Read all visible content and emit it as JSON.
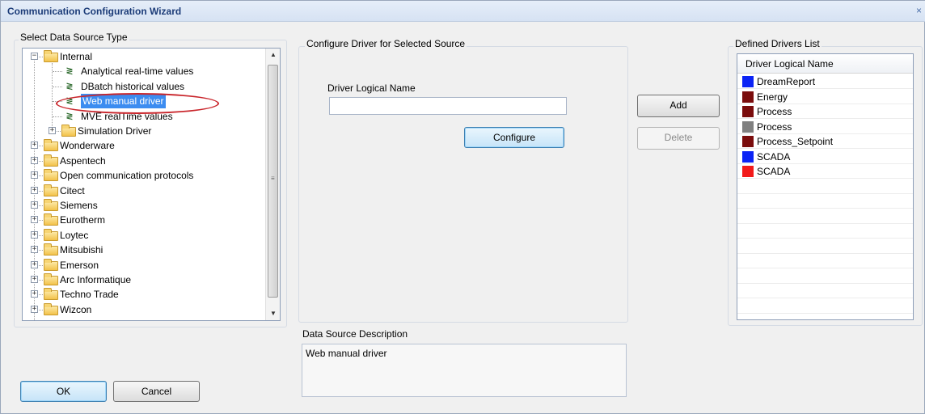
{
  "window": {
    "title": "Communication Configuration Wizard",
    "close_glyph": "×"
  },
  "source_type": {
    "label": "Select Data Source Type",
    "tree": [
      {
        "label": "Internal",
        "level": 0,
        "kind": "folder",
        "expander": "−"
      },
      {
        "label": "Analytical real-time values",
        "level": 1,
        "kind": "driver"
      },
      {
        "label": "DBatch historical values",
        "level": 1,
        "kind": "driver"
      },
      {
        "label": "Web manual driver",
        "level": 1,
        "kind": "driver",
        "selected": true
      },
      {
        "label": "MVE realTime values",
        "level": 1,
        "kind": "driver"
      },
      {
        "label": "Simulation Driver",
        "level": 1,
        "kind": "folder",
        "expander": "+"
      },
      {
        "label": "Wonderware",
        "level": 0,
        "kind": "folder",
        "expander": "+"
      },
      {
        "label": "Aspentech",
        "level": 0,
        "kind": "folder",
        "expander": "+"
      },
      {
        "label": "Open communication protocols",
        "level": 0,
        "kind": "folder",
        "expander": "+"
      },
      {
        "label": "Citect",
        "level": 0,
        "kind": "folder",
        "expander": "+"
      },
      {
        "label": "Siemens",
        "level": 0,
        "kind": "folder",
        "expander": "+"
      },
      {
        "label": "Eurotherm",
        "level": 0,
        "kind": "folder",
        "expander": "+"
      },
      {
        "label": "Loytec",
        "level": 0,
        "kind": "folder",
        "expander": "+"
      },
      {
        "label": "Mitsubishi",
        "level": 0,
        "kind": "folder",
        "expander": "+"
      },
      {
        "label": "Emerson",
        "level": 0,
        "kind": "folder",
        "expander": "+"
      },
      {
        "label": "Arc Informatique",
        "level": 0,
        "kind": "folder",
        "expander": "+"
      },
      {
        "label": "Techno Trade",
        "level": 0,
        "kind": "folder",
        "expander": "+"
      },
      {
        "label": "Wizcon",
        "level": 0,
        "kind": "folder",
        "expander": "+"
      }
    ],
    "scroll_up_glyph": "▲",
    "scroll_down_glyph": "▼"
  },
  "configure": {
    "label": "Configure Driver for Selected Source",
    "driver_name_label": "Driver Logical Name",
    "driver_name_value": "",
    "configure_button": "Configure"
  },
  "actions": {
    "add_button": "Add",
    "delete_button": "Delete"
  },
  "defined_drivers": {
    "label": "Defined Drivers List",
    "column_header": "Driver Logical Name",
    "rows": [
      {
        "name": "DreamReport",
        "color": "#0b23f5"
      },
      {
        "name": "Energy",
        "color": "#7a0c0c"
      },
      {
        "name": "Process",
        "color": "#7a0c0c"
      },
      {
        "name": "Process",
        "color": "#808080"
      },
      {
        "name": "Process_Setpoint",
        "color": "#7a0c0c"
      },
      {
        "name": "SCADA",
        "color": "#0b23f5"
      },
      {
        "name": "SCADA",
        "color": "#f21a1a"
      }
    ]
  },
  "description": {
    "label": "Data Source Description",
    "value": "Web manual driver"
  },
  "footer": {
    "ok_button": "OK",
    "cancel_button": "Cancel"
  }
}
